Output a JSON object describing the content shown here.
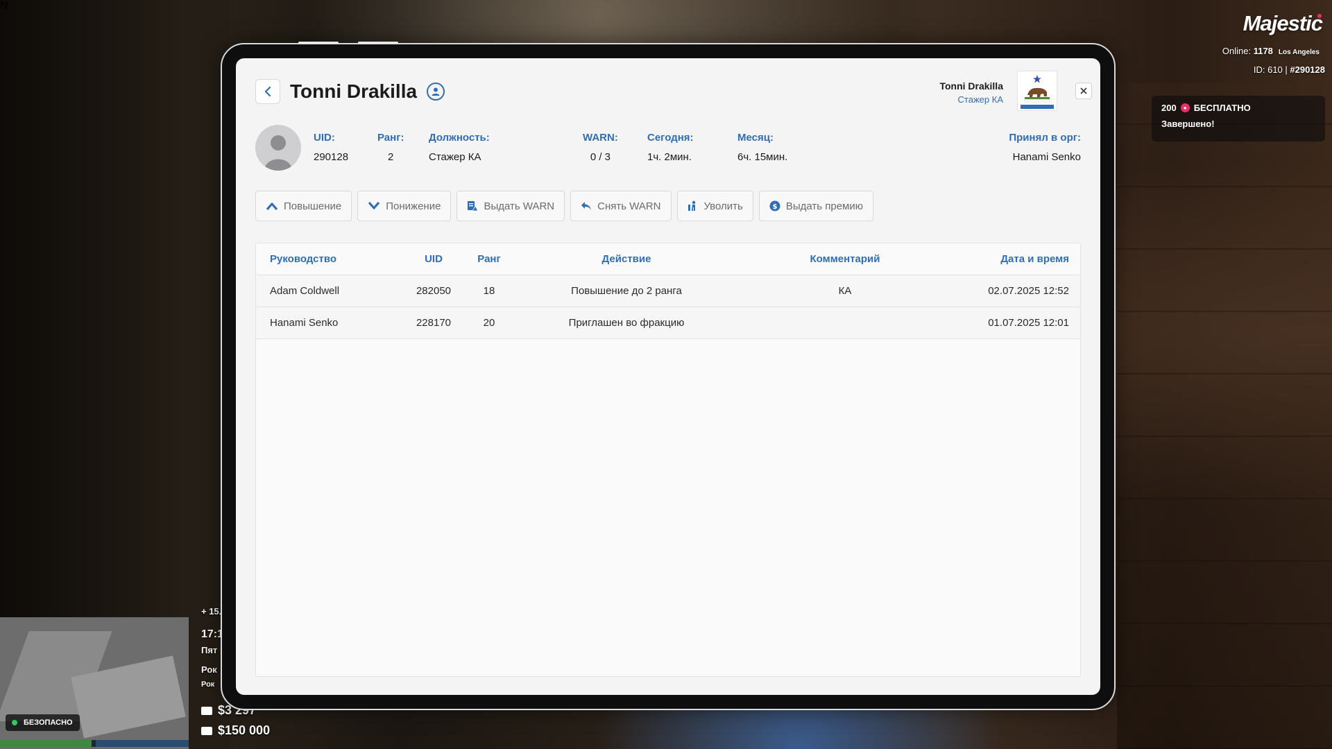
{
  "hud": {
    "brand": "Majestic",
    "online_label": "Online:",
    "online_count": "1178",
    "city": "Los Angeles",
    "id_text": "ID: 610 | ",
    "id_hash": "#290128",
    "promo_amount": "200",
    "promo_free": "БЕСПЛАТНО",
    "promo_status": "Завершено!",
    "safe_label": "БЕЗОПАСНО",
    "compass": "N",
    "time_partial": "17:1",
    "day_partial": "Пят",
    "loc_partial1": "Рок",
    "loc_partial2": "Рок",
    "delta_partial": "+ 15.",
    "cash": "$3 297",
    "bank": "$150 000"
  },
  "header": {
    "name": "Tonni Drakilla",
    "org_member_name": "Tonni Drakilla",
    "org_member_rank": "Стажер КА"
  },
  "profile": {
    "uid_label": "UID:",
    "uid": "290128",
    "rank_label": "Ранг:",
    "rank": "2",
    "position_label": "Должность:",
    "position": "Стажер КА",
    "warn_label": "WARN:",
    "warn": "0 / 3",
    "today_label": "Сегодня:",
    "today": "1ч. 2мин.",
    "month_label": "Месяц:",
    "month": "6ч. 15мин.",
    "accepted_label": "Принял в орг:",
    "accepted_by": "Hanami Senko"
  },
  "actions": {
    "promote": "Повышение",
    "demote": "Понижение",
    "give_warn": "Выдать WARN",
    "remove_warn": "Снять WARN",
    "fire": "Уволить",
    "bonus": "Выдать премию"
  },
  "table": {
    "headers": {
      "leader": "Руководство",
      "uid": "UID",
      "rank": "Ранг",
      "action": "Действие",
      "comment": "Комментарий",
      "datetime": "Дата и время"
    },
    "rows": [
      {
        "leader": "Adam Coldwell",
        "uid": "282050",
        "rank": "18",
        "action": "Повышение до 2 ранга",
        "comment": "КА",
        "datetime": "02.07.2025 12:52"
      },
      {
        "leader": "Hanami Senko",
        "uid": "228170",
        "rank": "20",
        "action": "Приглашен во фракцию",
        "comment": "",
        "datetime": "01.07.2025 12:01"
      }
    ]
  },
  "colors": {
    "accent": "#2f6eb5",
    "text": "#1b1b1d",
    "muted": "#6a6a70",
    "safe": "#2ecc5a",
    "brand_dot": "#e6306a"
  }
}
